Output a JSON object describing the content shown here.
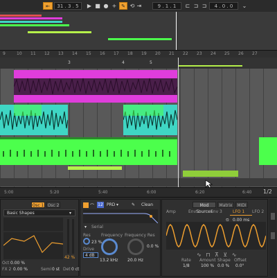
{
  "transport": {
    "tempo_value": "31 . 3 . 5",
    "position": "9 . 1 . 1",
    "loop_length": "4 . 0 . 0",
    "play_icon": "play-icon",
    "stop_icon": "stop-icon",
    "record_icon": "record-icon"
  },
  "ruler": {
    "bars": [
      "9",
      "10",
      "11",
      "12",
      "13",
      "14",
      "15",
      "16",
      "17",
      "18",
      "19",
      "20",
      "21",
      "22",
      "23",
      "24",
      "25",
      "26",
      "27"
    ]
  },
  "markers": [
    "3",
    "4",
    "5"
  ],
  "timeline": {
    "times": [
      "5:00",
      "5:20",
      "5:40",
      "6:00",
      "6:20",
      "6:40"
    ],
    "zoom_label": "1/2"
  },
  "device_simpler": {
    "tab_a": "Osc 1",
    "tab_b": "Osc 2",
    "preset": "Basic Shapes",
    "percent": "42 %",
    "fields": [
      {
        "label": "Oct",
        "value": "0.00 %"
      },
      {
        "label": "FX 2",
        "value": "0.00 %"
      },
      {
        "label": "Semi",
        "value": "0 st"
      },
      {
        "label": "Det",
        "value": "0 ct"
      }
    ]
  },
  "device_filter": {
    "circuit": "PRD",
    "mode": "Clean",
    "type_label": "Serial",
    "res_label": "Res",
    "res_value": "23 %",
    "drive_label": "Drive",
    "drive_value": "4 dB",
    "frequency_label": "Frequency",
    "frequency_value": "13.2 kHz",
    "freq_res_label": "Frequency Res",
    "freq_res_value": "20.0 Hz",
    "freq_res_pct": "0.0 %"
  },
  "device_mod": {
    "tabs": [
      "Amp",
      "Env 2",
      "Env 3",
      "LFO 1",
      "LFO 2"
    ],
    "active_tab": "LFO 1",
    "section_tabs": [
      "Mod Sources",
      "Matrix",
      "MIDI"
    ],
    "time_value": "0.00 ms",
    "rate_label": "Rate",
    "rate_value": "1/8",
    "amount_label": "Amount",
    "amount_value": "100 %",
    "shape_label": "Shape",
    "shape_value": "0.0 %",
    "offset_label": "Offset",
    "offset_value": "0.0°"
  },
  "colors": {
    "magenta": "#e03ddc",
    "cyan": "#3fd6c4",
    "green": "#4cff4c",
    "lime": "#b5f04a",
    "orange": "#f0a030"
  }
}
